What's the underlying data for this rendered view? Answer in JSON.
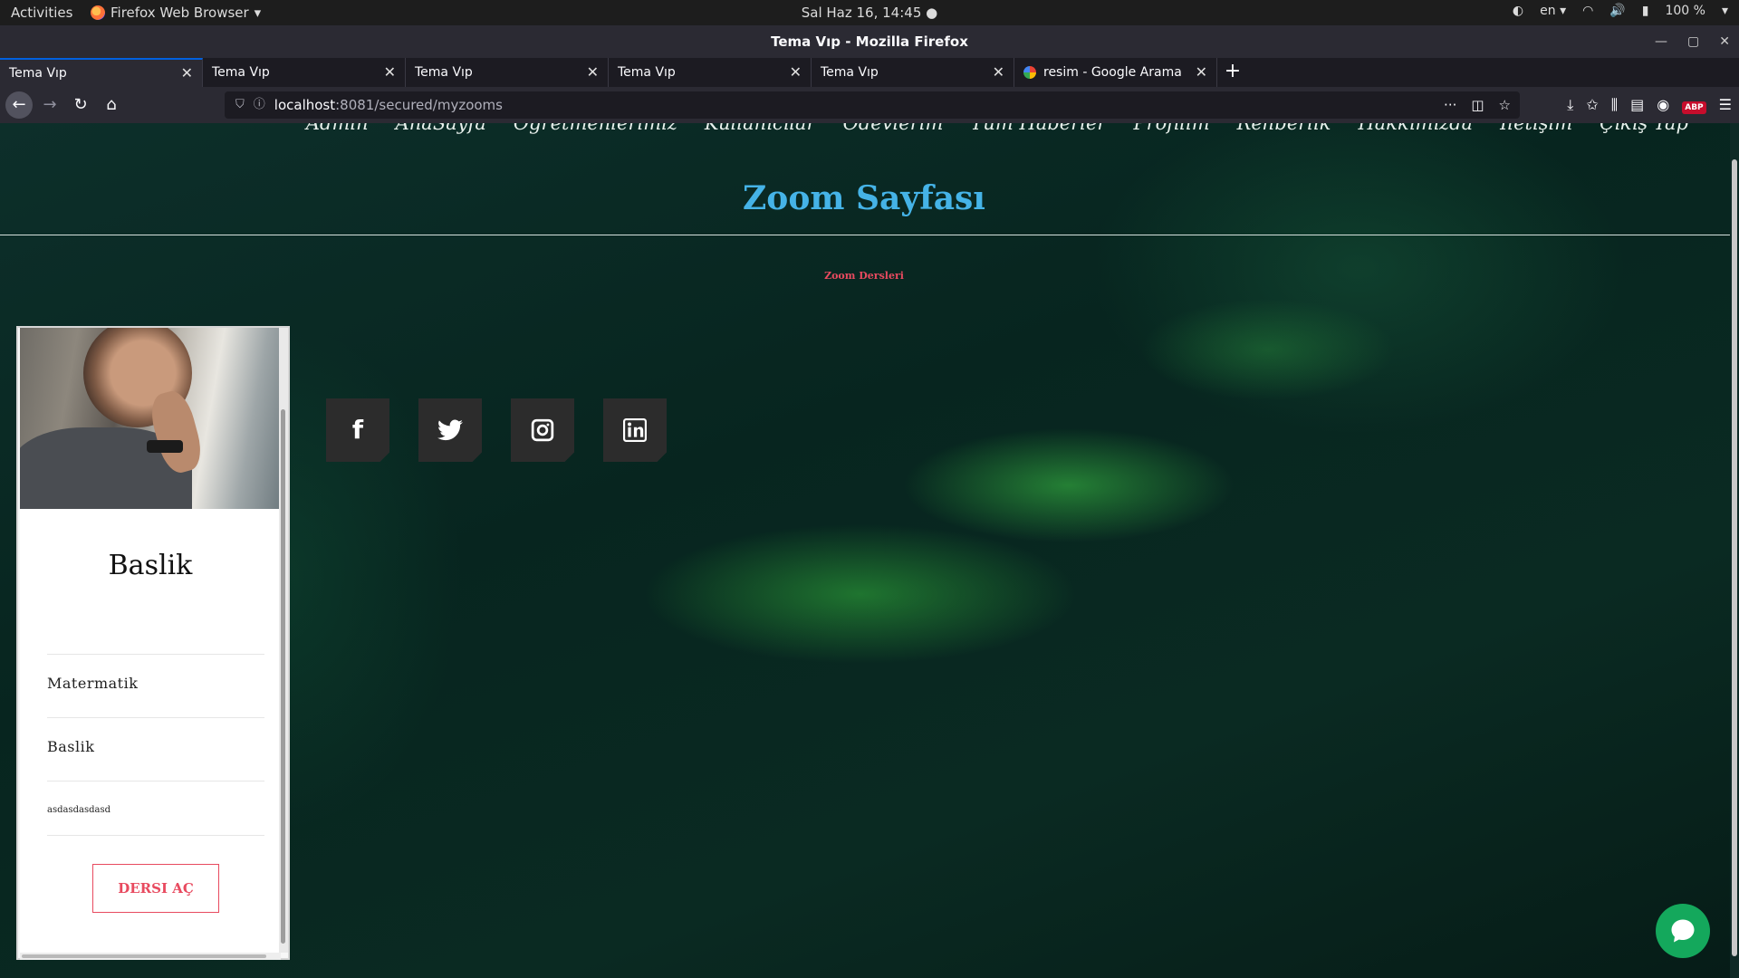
{
  "system": {
    "activities": "Activities",
    "app_name": "Firefox Web Browser",
    "clock": "Sal Haz 16, 14:45",
    "lang": "en",
    "battery": "100 %"
  },
  "window": {
    "title": "Tema Vıp - Mozilla Firefox"
  },
  "tabs": [
    {
      "label": "Tema Vıp"
    },
    {
      "label": "Tema Vıp"
    },
    {
      "label": "Tema Vıp"
    },
    {
      "label": "Tema Vıp"
    },
    {
      "label": "Tema Vıp"
    },
    {
      "label": "resim - Google Arama"
    }
  ],
  "address": {
    "host": "localhost",
    "rest": ":8081/secured/myzooms"
  },
  "nav": {
    "items": [
      "Admin",
      "AnaSayfa",
      "Öğretmenlerimiz",
      "Kullanıcılar",
      "Ödevlerim",
      "Tüm Haberler",
      "Profilim",
      "Rehberlik",
      "Hakkımızda",
      "İletişim",
      "Çıkış Yap"
    ]
  },
  "page": {
    "title": "Zoom Sayfası",
    "subtitle": "Zoom Dersleri"
  },
  "card": {
    "title": "Baslik",
    "subject": "Matermatik",
    "heading": "Baslik",
    "description": "asdasdasdasd",
    "button_label": "DERSI AÇ"
  },
  "social": {
    "facebook": "f",
    "twitter": "t",
    "instagram": "◎",
    "linkedin": "in"
  },
  "colors": {
    "accent_blue": "#45b3e7",
    "accent_red": "#e84a5f",
    "chat_green": "#14a85c"
  }
}
